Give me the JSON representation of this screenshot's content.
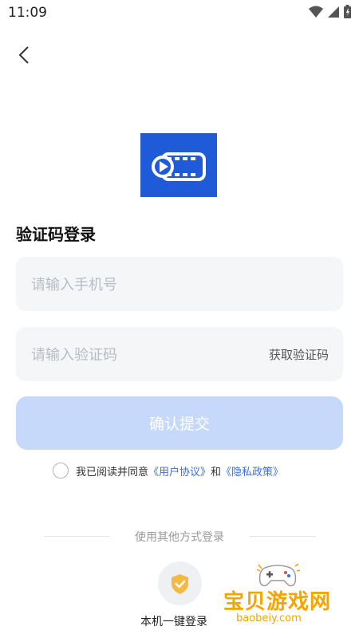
{
  "status": {
    "time": "11:09"
  },
  "page": {
    "title": "验证码登录"
  },
  "phone": {
    "placeholder": "请输入手机号"
  },
  "code": {
    "placeholder": "请输入验证码",
    "get_code_label": "获取验证码"
  },
  "submit": {
    "label": "确认提交"
  },
  "agreement": {
    "prefix": "我已阅读并同意",
    "user_agreement": "《用户协议》",
    "and": "和",
    "privacy_policy": "《隐私政策》"
  },
  "other_login": {
    "label": "使用其他方式登录",
    "one_click_label": "本机一键登录",
    "one_click_icon": "shield-check-icon"
  },
  "watermark": {
    "title": "宝贝游戏网",
    "url": "baobeiy.com"
  },
  "colors": {
    "accent": "#1f5bd8",
    "link": "#3a6edc",
    "button_disabled": "#c6d9fb",
    "shield": "#f4b942"
  }
}
